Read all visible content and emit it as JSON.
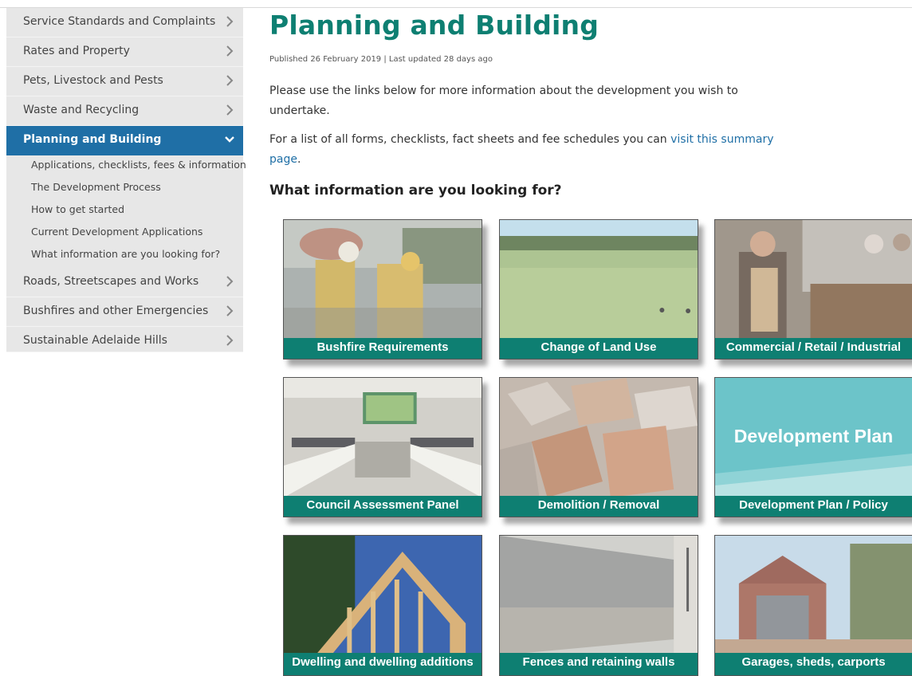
{
  "sidebar": {
    "items": [
      {
        "label": "Service Standards and Complaints"
      },
      {
        "label": "Rates and Property"
      },
      {
        "label": "Pets, Livestock and Pests"
      },
      {
        "label": "Waste and Recycling"
      },
      {
        "label": "Planning and Building"
      },
      {
        "label": "Roads, Streetscapes and Works"
      },
      {
        "label": "Bushfires and other Emergencies"
      },
      {
        "label": "Sustainable Adelaide Hills"
      }
    ],
    "subitems": [
      {
        "label": "Applications, checklists, fees & information"
      },
      {
        "label": "The Development Process"
      },
      {
        "label": "How to get started"
      },
      {
        "label": "Current Development Applications"
      },
      {
        "label": "What information are you looking for?"
      }
    ]
  },
  "page": {
    "title": "Planning and Building",
    "meta": "Published 26 February 2019 | Last updated 28 days ago",
    "intro": "Please use the links below for more information about the development you wish to undertake.",
    "forms_prefix": "For a list of all forms, checklists, fact sheets and fee schedules you can ",
    "forms_link": "visit this summary page",
    "forms_suffix": ".",
    "subheading": "What information are you looking for?"
  },
  "tiles": [
    {
      "caption": "Bushfire Requirements"
    },
    {
      "caption": "Change of Land Use"
    },
    {
      "caption": "Commercial / Retail / Industrial"
    },
    {
      "caption": "Council Assessment Panel"
    },
    {
      "caption": "Demolition / Removal"
    },
    {
      "caption": "Development Plan / Policy"
    },
    {
      "caption": "Dwelling and dwelling additions"
    },
    {
      "caption": "Fences and retaining walls"
    },
    {
      "caption": "Garages, sheds, carports"
    }
  ],
  "tile_texts": {
    "development_plan_banner": "Development Plan"
  },
  "colors": {
    "accent_teal": "#0e7f72",
    "nav_active": "#1f6fa6",
    "link": "#1f6fa6"
  },
  "icons": {
    "collapsed": "chevron-right-icon",
    "expanded": "chevron-down-icon"
  }
}
